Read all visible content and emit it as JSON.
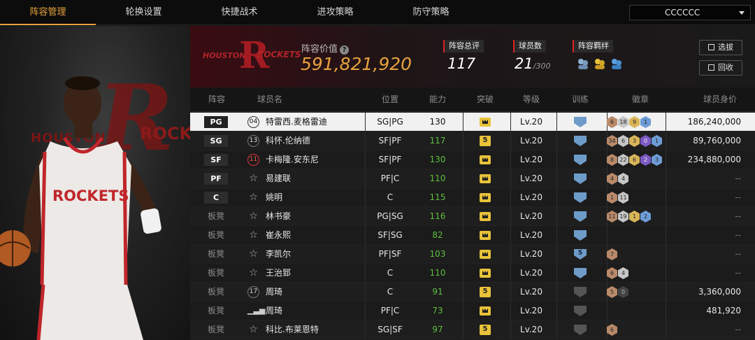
{
  "nav": {
    "tabs": [
      "阵容管理",
      "轮换设置",
      "快捷战术",
      "进攻策略",
      "防守策略"
    ],
    "active_tab": 0,
    "dropdown_value": "CCCCCC"
  },
  "team": {
    "logo_text_left": "HOUSTON",
    "logo_text_right": "ROCKETS",
    "logo_letter": "R",
    "value_label": "阵容价值",
    "value": "591,821,920",
    "overall_label": "阵容总评",
    "overall": "117",
    "count_label": "球员数",
    "count": "21",
    "count_max": "/300",
    "bond_label": "阵容羁绊",
    "select_button": "选拔",
    "recycle_button": "回收"
  },
  "art": {
    "houston": "HOUSTON",
    "rockets": "ROCKETS"
  },
  "table": {
    "headers": [
      "阵容",
      "球员名",
      "位置",
      "能力",
      "突破",
      "等级",
      "训练",
      "徽章",
      "球员身价"
    ],
    "rows": [
      {
        "slot": "PG",
        "starter": true,
        "jersey": "04",
        "jersey_style": "circle",
        "name": "特雷西.麦格雷迪",
        "position": "SG|PG",
        "ability": "130",
        "breakthrough": "crown",
        "level": "Lv.20",
        "training": "shield",
        "badges": [
          [
            "bronze",
            "6"
          ],
          [
            "silver",
            "18"
          ],
          [
            "gold",
            "9"
          ],
          [
            "blue",
            "1"
          ]
        ],
        "price": "186,240,000"
      },
      {
        "slot": "SG",
        "starter": true,
        "jersey": "13",
        "jersey_style": "plain",
        "name": "科怀.伦纳德",
        "position": "SF|PF",
        "ability": "117",
        "breakthrough": "5",
        "level": "Lv.20",
        "training": "shield",
        "badges": [
          [
            "bronze",
            "34"
          ],
          [
            "silver",
            "6"
          ],
          [
            "gold",
            "3"
          ],
          [
            "purple",
            "0"
          ],
          [
            "blue",
            "1"
          ]
        ],
        "price": "89,760,000"
      },
      {
        "slot": "SF",
        "starter": true,
        "jersey": "11",
        "jersey_style": "red",
        "name": "卡梅隆.安东尼",
        "position": "SF|PF",
        "ability": "130",
        "breakthrough": "crown",
        "level": "Lv.20",
        "training": "shield",
        "badges": [
          [
            "bronze",
            "8"
          ],
          [
            "silver",
            "22"
          ],
          [
            "gold",
            "6"
          ],
          [
            "purple",
            "2"
          ],
          [
            "blue",
            "3"
          ]
        ],
        "price": "234,880,000"
      },
      {
        "slot": "PF",
        "starter": true,
        "jersey": "☆",
        "jersey_style": "star",
        "name": "易建联",
        "position": "PF|C",
        "ability": "110",
        "breakthrough": "crown",
        "level": "Lv.20",
        "training": "shield",
        "badges": [
          [
            "bronze",
            "4"
          ],
          [
            "silver",
            "4"
          ]
        ],
        "price": "--"
      },
      {
        "slot": "C",
        "starter": true,
        "jersey": "☆",
        "jersey_style": "star",
        "name": "姚明",
        "position": "C",
        "ability": "115",
        "breakthrough": "crown",
        "level": "Lv.20",
        "training": "shield",
        "badges": [
          [
            "bronze",
            "1"
          ],
          [
            "silver",
            "11"
          ]
        ],
        "price": "--"
      },
      {
        "slot": "板凳",
        "starter": false,
        "jersey": "☆",
        "jersey_style": "star",
        "name": "林书豪",
        "position": "PG|SG",
        "ability": "116",
        "breakthrough": "crown",
        "level": "Lv.20",
        "training": "shield",
        "badges": [
          [
            "bronze",
            "11"
          ],
          [
            "silver",
            "19"
          ],
          [
            "gold",
            "1"
          ],
          [
            "blue",
            "2"
          ]
        ],
        "price": "--"
      },
      {
        "slot": "板凳",
        "starter": false,
        "jersey": "☆",
        "jersey_style": "star",
        "name": "崔永熙",
        "position": "SF|SG",
        "ability": "82",
        "breakthrough": "crown",
        "level": "Lv.20",
        "training": "shield",
        "badges": [],
        "price": "--"
      },
      {
        "slot": "板凳",
        "starter": false,
        "jersey": "☆",
        "jersey_style": "star",
        "name": "李凯尔",
        "position": "PF|SF",
        "ability": "103",
        "breakthrough": "crown",
        "level": "Lv.20",
        "training": "shield5",
        "badges": [
          [
            "bronze",
            "7"
          ]
        ],
        "price": "--"
      },
      {
        "slot": "板凳",
        "starter": false,
        "jersey": "☆",
        "jersey_style": "star",
        "name": "王治郅",
        "position": "C",
        "ability": "110",
        "breakthrough": "crown",
        "level": "Lv.20",
        "training": "shield",
        "badges": [
          [
            "bronze",
            "6"
          ],
          [
            "silver",
            "4"
          ]
        ],
        "price": "--"
      },
      {
        "slot": "板凳",
        "starter": false,
        "jersey": "17",
        "jersey_style": "plain",
        "name": "周琦",
        "position": "C",
        "ability": "91",
        "breakthrough": "5",
        "level": "Lv.20",
        "training": "gray",
        "badges": [
          [
            "bronze",
            "5"
          ],
          [
            "dark",
            "0"
          ]
        ],
        "price": "3,360,000"
      },
      {
        "slot": "板凳",
        "starter": false,
        "jersey": "bars",
        "jersey_style": "bars",
        "name": "周琦",
        "position": "PF|C",
        "ability": "73",
        "breakthrough": "crown",
        "level": "Lv.20",
        "training": "gray",
        "badges": [],
        "price": "481,920"
      },
      {
        "slot": "板凳",
        "starter": false,
        "jersey": "☆",
        "jersey_style": "star",
        "name": "科比.布莱恩特",
        "position": "SG|SF",
        "ability": "97",
        "breakthrough": "5",
        "level": "Lv.20",
        "training": "gray",
        "badges": [
          [
            "bronze",
            "6"
          ]
        ],
        "price": "--"
      }
    ]
  },
  "colors": {
    "accent": "#e6a23c",
    "green": "#5fbf3f",
    "team_red": "#a31b22",
    "gold_badge": "#e8c23a",
    "shield_blue": "#6e9cc9"
  }
}
